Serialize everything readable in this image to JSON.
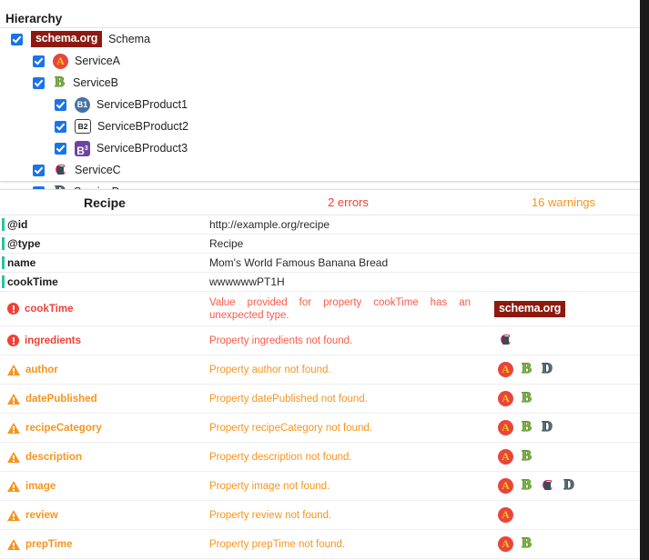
{
  "hierarchy": {
    "title": "Hierarchy",
    "nodes": [
      {
        "level": 0,
        "checked": true,
        "icon": "schema-org-badge",
        "badge": "schema.org",
        "label": "Schema"
      },
      {
        "level": 1,
        "checked": true,
        "icon": "service-a-icon",
        "label": "ServiceA"
      },
      {
        "level": 1,
        "checked": true,
        "icon": "service-b-icon",
        "label": "ServiceB"
      },
      {
        "level": 2,
        "checked": true,
        "icon": "service-b-product1-icon",
        "label": "ServiceBProduct1"
      },
      {
        "level": 2,
        "checked": true,
        "icon": "service-b-product2-icon",
        "label": "ServiceBProduct2"
      },
      {
        "level": 2,
        "checked": true,
        "icon": "service-b-product3-icon",
        "label": "ServiceBProduct3"
      },
      {
        "level": 1,
        "checked": true,
        "icon": "service-c-icon",
        "label": "ServiceC"
      },
      {
        "level": 1,
        "checked": true,
        "icon": "service-d-icon",
        "label": "ServiceD"
      }
    ]
  },
  "results": {
    "header": {
      "type_label": "Recipe",
      "errors_label": "2 errors",
      "warnings_label": "16 warnings"
    },
    "properties": [
      {
        "key": "@id",
        "value": "http://example.org/recipe"
      },
      {
        "key": "@type",
        "value": "Recipe"
      },
      {
        "key": "name",
        "value": "Mom's World Famous Banana Bread"
      },
      {
        "key": "cookTime",
        "value": "wwwwwwPT1H"
      }
    ],
    "issues": [
      {
        "severity": "error",
        "key": "cookTime",
        "message": "Value provided for property cookTime has an unexpected type.",
        "vocabs": [
          "schema.org"
        ]
      },
      {
        "severity": "error",
        "key": "ingredients",
        "message": "Property ingredients not found.",
        "vocabs": [
          "C"
        ]
      },
      {
        "severity": "warning",
        "key": "author",
        "message": "Property author not found.",
        "vocabs": [
          "A",
          "B",
          "D"
        ]
      },
      {
        "severity": "warning",
        "key": "datePublished",
        "message": "Property datePublished not found.",
        "vocabs": [
          "A",
          "B"
        ]
      },
      {
        "severity": "warning",
        "key": "recipeCategory",
        "message": "Property recipeCategory not found.",
        "vocabs": [
          "A",
          "B",
          "D"
        ]
      },
      {
        "severity": "warning",
        "key": "description",
        "message": "Property description not found.",
        "vocabs": [
          "A",
          "B"
        ]
      },
      {
        "severity": "warning",
        "key": "image",
        "message": "Property image not found.",
        "vocabs": [
          "A",
          "B",
          "C",
          "D"
        ]
      },
      {
        "severity": "warning",
        "key": "review",
        "message": "Property review not found.",
        "vocabs": [
          "A"
        ]
      },
      {
        "severity": "warning",
        "key": "prepTime",
        "message": "Property prepTime not found.",
        "vocabs": [
          "A",
          "B"
        ]
      }
    ]
  },
  "colors": {
    "error": "#ef4136",
    "warning": "#f7941e",
    "checkbox": "#1a73e8",
    "schema_badge": "#8c1a10",
    "accent_bar": "#29c3a5"
  }
}
